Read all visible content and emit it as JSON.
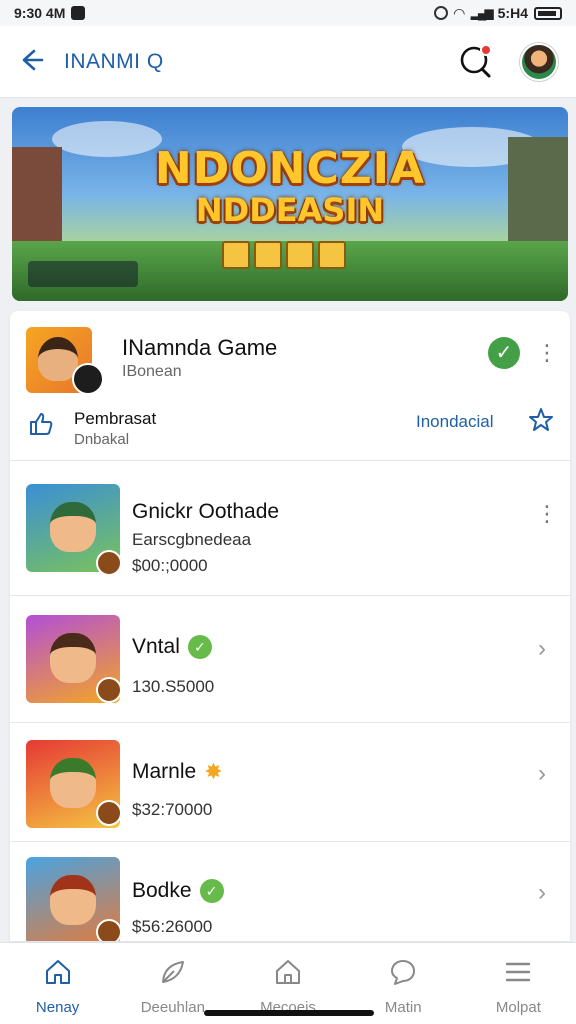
{
  "status_bar": {
    "time": "9:30 4M",
    "right_text": "5:H4"
  },
  "header": {
    "title": "INANMI Q"
  },
  "banner": {
    "title_line1": "NDONCZIA",
    "title_line2": "NDDEASIN"
  },
  "featured": {
    "title": "INamnda Game",
    "subtitle": "IBonean",
    "action_label": "Pembrasat",
    "action_sublabel": "Dnbakal",
    "link": "Inondacial",
    "verified_color": "#43a047"
  },
  "games": [
    {
      "title": "Gnickr Oothade",
      "line": "Earscgbnedeaa",
      "price": "$00:;0000",
      "badge": "none",
      "action": "kebab"
    },
    {
      "title": "Vntal",
      "line": "",
      "price": "130.S5000",
      "badge": "verified",
      "action": "chevron"
    },
    {
      "title": "Marnle",
      "line": "",
      "price": "$32:70000",
      "badge": "sun",
      "action": "chevron"
    },
    {
      "title": "Bodke",
      "line": "",
      "price": "$56:26000",
      "badge": "verified",
      "action": "chevron"
    }
  ],
  "bottom_nav": [
    {
      "label": "Nenay",
      "icon": "home-icon",
      "active": true
    },
    {
      "label": "Deeuhlan",
      "icon": "leaf-icon",
      "active": false
    },
    {
      "label": "Mecoeis",
      "icon": "house-icon",
      "active": false
    },
    {
      "label": "Matin",
      "icon": "chat-icon",
      "active": false
    },
    {
      "label": "Molpat",
      "icon": "menu-icon",
      "active": false
    }
  ],
  "colors": {
    "accent": "#1f5fa8",
    "verified": "#66bb4a",
    "notification": "#e53935"
  }
}
